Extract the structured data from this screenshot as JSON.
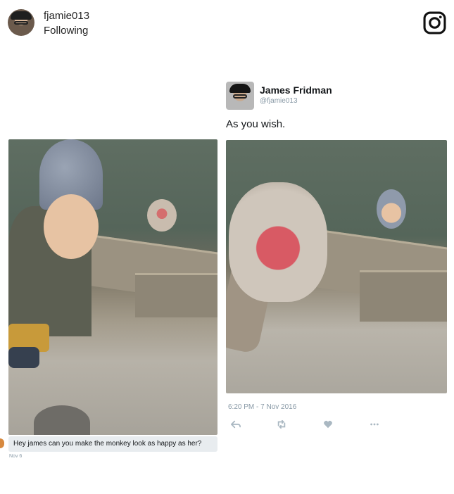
{
  "header": {
    "username": "fjamie013",
    "status": "Following",
    "logo_icon": "instagram-icon"
  },
  "tweet": {
    "name": "James Fridman",
    "handle": "@fjamie013",
    "text": "As you wish.",
    "timestamp": "6:20 PM - 7 Nov 2016",
    "actions": [
      "reply-icon",
      "retweet-icon",
      "like-icon",
      "more-icon"
    ]
  },
  "request": {
    "text": "Hey james can you make the monkey look as happy as her?",
    "date": "Nov 6"
  }
}
